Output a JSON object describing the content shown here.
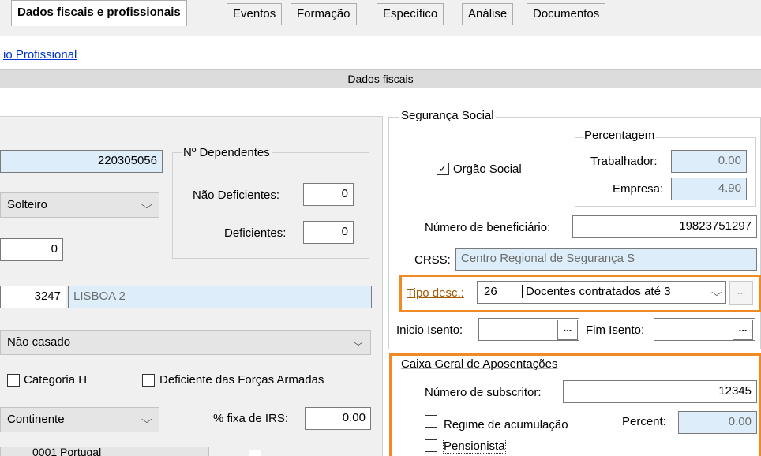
{
  "tabs": [
    "Dados fiscais e profissionais",
    "Eventos",
    "Formação",
    "Específico",
    "Análise",
    "Documentos"
  ],
  "link_text": "io Profissional",
  "section_bar": "Dados fiscais",
  "left": {
    "nif_value": "220305056",
    "estado_civil": "Solteiro",
    "field_zero": "0",
    "reparticao_code": "3247",
    "reparticao_name": "LISBOA 2",
    "titular": "Não casado",
    "categoria_h": "Categoria H",
    "deficiente_fa": "Deficiente das Forças Armadas",
    "regiao": "Continente",
    "irs_label": "% fixa de IRS:",
    "irs_value": "0.00",
    "bottom_partial": "0001 Portugal"
  },
  "dependentes": {
    "title": "Nº Dependentes",
    "nao_def_label": "Não Deficientes:",
    "nao_def_value": "0",
    "def_label": "Deficientes:",
    "def_value": "0"
  },
  "seg_social": {
    "title": "Segurança Social",
    "orgao_social": "Orgão Social",
    "percentagem": "Percentagem",
    "trabalhador_label": "Trabalhador:",
    "trabalhador_value": "0.00",
    "empresa_label": "Empresa:",
    "empresa_value": "4.90",
    "num_benef_label": "Número de beneficiário:",
    "num_benef_value": "19823751297",
    "crss_label": "CRSS:",
    "crss_value": "Centro Regional de Segurança S",
    "tipo_desc_label": "Tipo desc.:",
    "tipo_desc_code": "26",
    "tipo_desc_text": "Docentes contratados até 3",
    "inicio_label": "Inicio Isento:",
    "fim_label": "Fim Isento:",
    "ellipsis": "..."
  },
  "cga": {
    "title": "Caixa Geral de Aposentações",
    "num_sub_label": "Número de subscritor:",
    "num_sub_value": "12345",
    "regime": "Regime de acumulação",
    "percent_label": "Percent:",
    "percent_value": "0.00",
    "pensionista": "Pensionista"
  },
  "colors": {
    "accent": "#f08a24",
    "link": "#0033cc",
    "input_blue": "#ddeefa"
  }
}
